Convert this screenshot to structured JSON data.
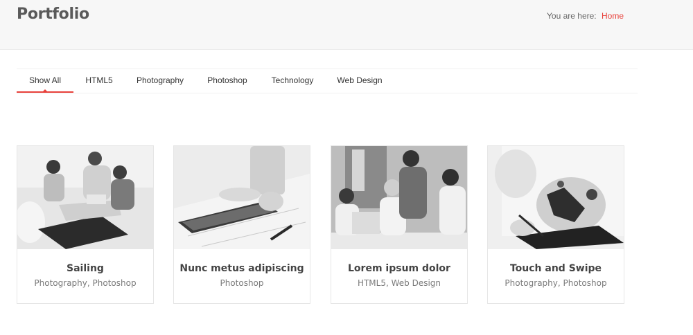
{
  "header": {
    "title": "Portfolio",
    "breadcrumb_prefix": "You are here:",
    "breadcrumb_home": "Home"
  },
  "filters": [
    {
      "label": "Show All",
      "active": true
    },
    {
      "label": "HTML5",
      "active": false
    },
    {
      "label": "Photography",
      "active": false
    },
    {
      "label": "Photoshop",
      "active": false
    },
    {
      "label": "Technology",
      "active": false
    },
    {
      "label": "Web Design",
      "active": false
    }
  ],
  "portfolio": [
    {
      "title": "Sailing",
      "categories": "Photography, Photoshop",
      "image": "team-meeting-photo"
    },
    {
      "title": "Nunc metus adipiscing",
      "categories": "Photoshop",
      "image": "tablet-hands-photo"
    },
    {
      "title": "Lorem ipsum dolor",
      "categories": "HTML5, Web Design",
      "image": "office-group-photo"
    },
    {
      "title": "Touch and Swipe",
      "categories": "Photography, Photoshop",
      "image": "drawing-tshirt-photo"
    }
  ],
  "colors": {
    "accent": "#e8403a",
    "header_bg": "#f7f7f7",
    "title": "#5a5a5a"
  }
}
